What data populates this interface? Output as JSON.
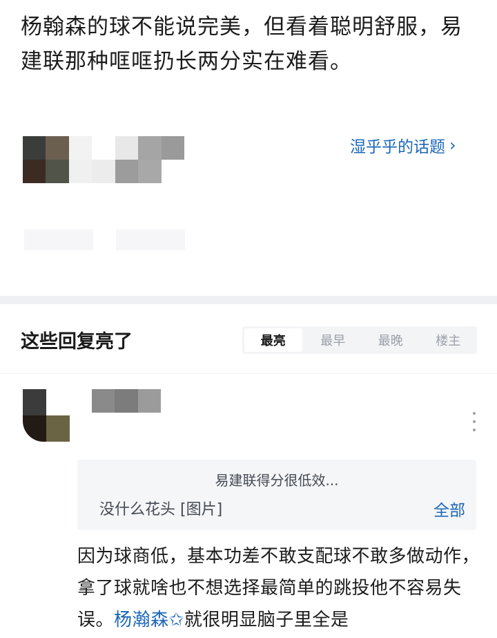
{
  "post": {
    "text": "杨翰森的球不能说完美，但看着聪明舒服，易建联那种哐哐扔长两分实在难看。"
  },
  "topic_link": {
    "label": "湿乎乎的话题",
    "chevron": "›"
  },
  "avatar_mosaic_colors": [
    "#3a3d3a",
    "#6b6050",
    "#f2f2f2",
    "#ffffff",
    "#e8e8e8",
    "#a5a5a5",
    "#9a9a9a",
    "#3b2b22",
    "#505449",
    "#f0f0f0",
    "#ececec",
    "#9c9c9c",
    "#a8a8a8",
    "#ffffff"
  ],
  "replies": {
    "title": "这些回复亮了",
    "sort_tabs": [
      "最亮",
      "最早",
      "最晚",
      "楼主"
    ],
    "active_tab": "最亮"
  },
  "comment": {
    "avatar_colors": [
      "#3b3b3b",
      "#ffffff",
      "#221a14",
      "#6a6445"
    ],
    "name_mosaic_colors": [
      "#8a8a8a",
      "#7c7c7c",
      "#9b9b9b"
    ],
    "quote": {
      "line1": "易建联得分很低效...",
      "line2": "没什么花头 [图片]",
      "expand_label": "全部"
    },
    "text_before_mention": "因为球商低，基本功差不敢支配球不敢多做动作，拿了球就啥也不想选择最简单的跳投他不容易失误。",
    "mention": "杨瀚森",
    "mention_icon": "✩",
    "text_after_mention": "就很明显脑子里全是"
  },
  "icons": {
    "more": "more-vertical-icon"
  },
  "colors": {
    "link": "#1c67b8",
    "divider": "#eef0f3"
  }
}
